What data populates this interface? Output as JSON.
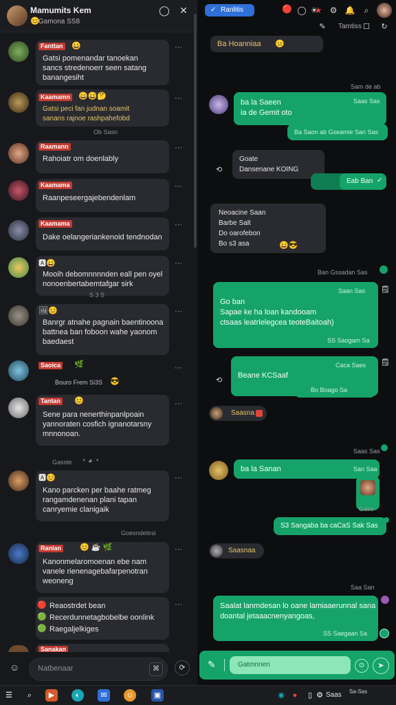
{
  "left": {
    "header": {
      "title": "Mamumits Kem",
      "subtitle": "Gamona  SS8",
      "icons": [
        "refresh-icon",
        "close-icon"
      ]
    },
    "messages": [
      {
        "name": "Fanttan",
        "text": "Gatsi pomenandar tanoekan\nsancs  stredenoerr seen  satang\nbanangesiht",
        "meta": ""
      },
      {
        "name": "Kaamamn",
        "text": "Gatsi peci fan judnan  soamit\nsanans rajnoe rashpahefobd",
        "meta": "Ob Sasn"
      },
      {
        "name": "Raamann",
        "text": "Rahoiatr om doenlably",
        "meta": ""
      },
      {
        "name": "Kaamama",
        "text": "Raanpeseergajebendenlam",
        "meta": ""
      },
      {
        "name": "Kaamama",
        "text": "Dake oelangeriankenoid tendnodan",
        "meta": ""
      },
      {
        "name": "",
        "text": "Mooih debomnnnnden eall pen oyel\nnonoenbertabemtafgar sirk",
        "meta": "S 3 S"
      },
      {
        "name": "",
        "text": "Banrgr atnahe pagnain baentinoona\nbattnea  ban foboon wahe yaonom\nbaedaest",
        "meta": ""
      },
      {
        "name": "Saoica",
        "text": "Bouro  Frem  Si3S",
        "meta": ""
      },
      {
        "name": "Tantan",
        "text": "Sene para  nenerthinpanlpoain\nyannoraten cosfich  ignanotarsny\nmnnonoan.",
        "meta": "Gasste"
      },
      {
        "name": "",
        "text": "Kano parcken per baahe ratmeg\nrangamdenenan plani tapan\ncanryemie clanigaik",
        "meta": "Goesndetirsi"
      },
      {
        "name": "Ranlan",
        "text": "Kanonmelaromoenan  ebe  nam\nvanele rienenagebafarpenotran\nweoneng",
        "meta": ""
      },
      {
        "name": "",
        "text": "Reaostrdet bean\nRecerdunnetagbobelbe oonlink\nRaegaljelkiges",
        "meta": ""
      },
      {
        "name": "Sanakan",
        "text": "",
        "meta": ""
      }
    ],
    "input": {
      "placeholder": "Natbenaar"
    }
  },
  "right": {
    "header": {
      "tab_label": "Ranlitis"
    },
    "toolbar": [
      "Tamtiss"
    ],
    "messages": [
      {
        "dir": "in",
        "text": "Ba Hoanniaa"
      },
      {
        "dir": "in",
        "time": "Sam de ab",
        "label": "Sani  Sam"
      },
      {
        "dir": "out",
        "text": "ba la Saeen\nia de  Gemit oto",
        "time": "Saas  Sas",
        "meta": "Ba Saon ab Gseamie San  Sas"
      },
      {
        "dir": "in",
        "text": "Goate\nDansenane KOING"
      },
      {
        "dir": "out",
        "text": "Eab  Ban"
      },
      {
        "dir": "in",
        "text": "Neoacine  Saan\nBarbe      Salt\nDo oarofebon\nBo  s3  asa"
      },
      {
        "dir": "out",
        "time": "Ban Gssadan  Sas",
        "text": "Go  ban\nSapae  ke ha  loan kandooam\nctsaas leatrlelegcea teoteBaitoah)",
        "label": "Saan  Sas",
        "meta": "SS  Saogam  Sa"
      },
      {
        "dir": "out",
        "text": "Beane  KCSaaf",
        "label": "Caca  Saes",
        "meta": "Bo  Boago  Sa"
      },
      {
        "dir": "in",
        "text": "Saasna"
      },
      {
        "dir": "out",
        "time": "Saas  Sas",
        "text": "ba la  Sanan",
        "label": "San  Saa",
        "meta": "Gaso"
      },
      {
        "dir": "out",
        "text": "S3  Sangaba  ba caCaS Sak  Sas"
      },
      {
        "dir": "in",
        "text": "Saasnaa"
      },
      {
        "dir": "out",
        "time": "Saa  San",
        "text": "Saalat lanmdesan lo oane lamiaaerunnal sana\ndoantal jetaaacnenyangoas,",
        "meta": "SS  Saegaan  Sa"
      }
    ],
    "input": {
      "placeholder": "Gatmnnen"
    }
  },
  "taskbar": {
    "clock": "Saas",
    "date": "Sa-Sas"
  }
}
